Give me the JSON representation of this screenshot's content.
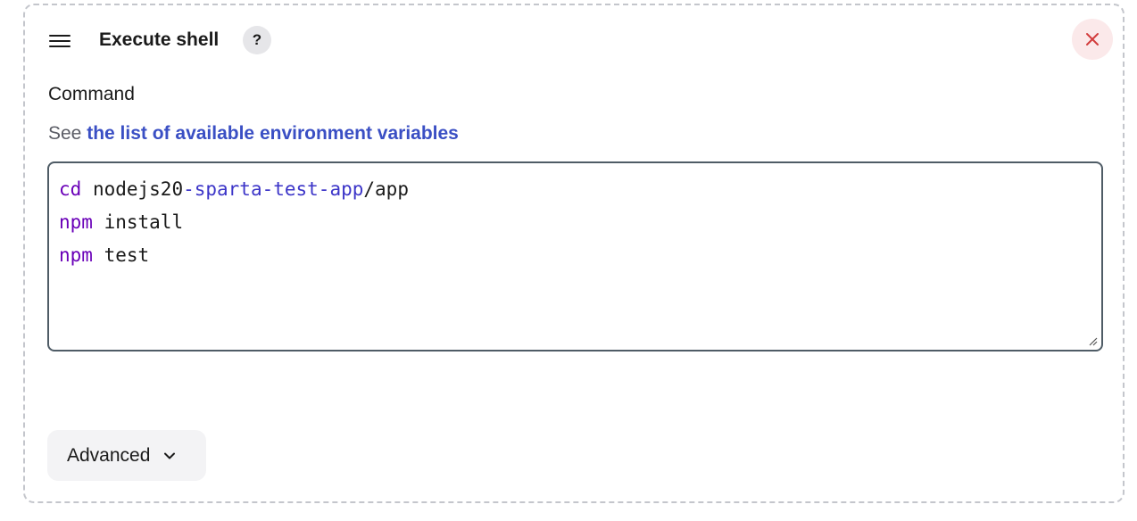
{
  "step": {
    "title": "Execute shell",
    "help_symbol": "?",
    "drag_icon": "hamburger-icon",
    "close_icon": "close-icon"
  },
  "command": {
    "label": "Command",
    "help_prefix": "See",
    "help_link": "the list of available environment variables",
    "lines": [
      {
        "keyword": "cd",
        "rest_a": " nodejs20",
        "op1": "-sparta-test-app",
        "rest_b": "/app"
      },
      {
        "keyword": "npm",
        "rest_a": " install"
      },
      {
        "keyword": "npm",
        "rest_a": " test"
      }
    ]
  },
  "advanced": {
    "label": "Advanced",
    "icon": "chevron-down-icon"
  },
  "colors": {
    "keyword": "#6a00b8",
    "link": "#3a4fc4",
    "close": "#d23c3c"
  }
}
